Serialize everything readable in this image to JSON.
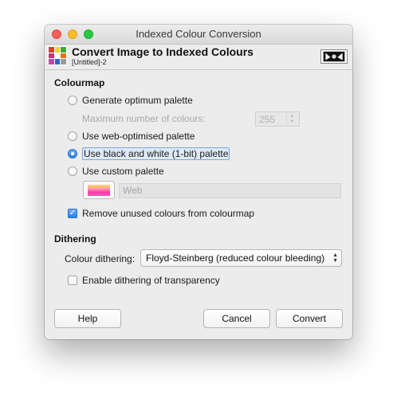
{
  "window": {
    "title": "Indexed Colour Conversion"
  },
  "header": {
    "title": "Convert Image to Indexed Colours",
    "subtitle": "[Untitled]-2"
  },
  "colourmap": {
    "section_label": "Colourmap",
    "options": {
      "generate_optimum": "Generate optimum palette",
      "web_optimised": "Use web-optimised palette",
      "black_white": "Use black and white (1-bit) palette",
      "custom": "Use custom palette"
    },
    "selected": "black_white",
    "max_colours_label": "Maximum number of colours:",
    "max_colours_value": "255",
    "custom_palette_name": "Web",
    "remove_unused_label": "Remove unused colours from colourmap",
    "remove_unused_checked": true
  },
  "dithering": {
    "section_label": "Dithering",
    "colour_dithering_label": "Colour dithering:",
    "colour_dithering_value": "Floyd-Steinberg (reduced colour bleeding)",
    "transparency_label": "Enable dithering of transparency",
    "transparency_checked": false
  },
  "buttons": {
    "help": "Help",
    "cancel": "Cancel",
    "convert": "Convert"
  },
  "icons": {
    "window_controls": [
      "close-icon",
      "minimize-icon",
      "maximize-icon"
    ],
    "app": "palette-grid-icon",
    "preview": "image-preview-icon"
  },
  "colors": {
    "accent": "#2a7fea",
    "close": "#fc5f57",
    "minimize": "#fdbc2e",
    "maximize": "#29c841"
  }
}
